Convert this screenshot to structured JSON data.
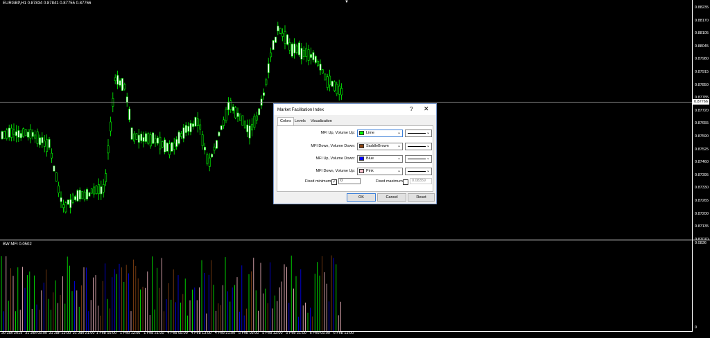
{
  "chart": {
    "info": "EURGBP,H1  0.87834 0.87841 0.87755 0.87766",
    "current_price": "0.87766",
    "price_labels": [
      "0.88235",
      "0.88170",
      "0.88105",
      "0.88045",
      "0.87980",
      "0.87915",
      "0.87850",
      "0.87785",
      "0.87720",
      "0.87655",
      "0.87590",
      "0.87525",
      "0.87460",
      "0.87395",
      "0.87330",
      "0.87265",
      "0.87200",
      "0.87135",
      "0.87070"
    ],
    "time_labels": [
      "30 Jan 2019",
      "31 Jan 05:00",
      "31 Jan 13:00",
      "31 Jan 21:00",
      "1 Feb 05:00",
      "1 Feb 13:00",
      "1 Feb 21:00",
      "4 Feb 05:00",
      "4 Feb 13:00",
      "4 Feb 21:00",
      "5 Feb 05:00",
      "5 Feb 13:00",
      "5 Feb 21:00",
      "6 Feb 05:00",
      "6 Feb 13:00"
    ],
    "indicator_info": "BW MFI 0.0502",
    "indicator_max": "0.0836",
    "indicator_min": "0"
  },
  "dialog": {
    "title": "Market Facilitation Index",
    "help": "?",
    "close": "✕",
    "tabs": [
      "Colors",
      "Levels",
      "Visualization"
    ],
    "rows": [
      {
        "label": "MFI Up, Volume Up:",
        "color_name": "Lime",
        "color": "#00ff00"
      },
      {
        "label": "MFI Down, Volume Down:",
        "color_name": "SaddleBrown",
        "color": "#8b4513"
      },
      {
        "label": "MFI Up, Volume Down:",
        "color_name": "Blue",
        "color": "#0000ff"
      },
      {
        "label": "MFI Down, Volume Up:",
        "color_name": "Pink",
        "color": "#ffc0cb"
      }
    ],
    "fixed_min_label": "Fixed minimum",
    "fixed_min_value": "0",
    "fixed_max_label": "Fixed maximum",
    "fixed_max_value": "0.08359",
    "ok": "OK",
    "cancel": "Cancel",
    "reset": "Reset"
  }
}
